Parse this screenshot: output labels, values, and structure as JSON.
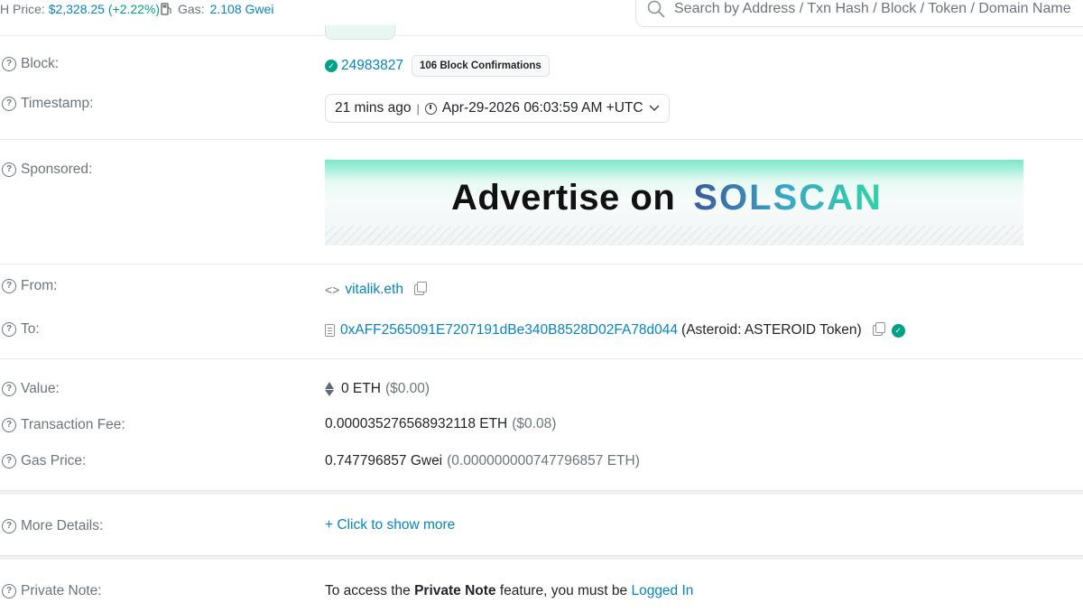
{
  "topbar": {
    "price_label": "H Price:",
    "price_value": "$2,328.25",
    "price_change": "(+2.22%)",
    "gas_label": "Gas:",
    "gas_value": "2.108 Gwei",
    "search_placeholder": "Search by Address / Txn Hash / Block / Token / Domain Name"
  },
  "rows": {
    "block": {
      "label": "Block:",
      "number": "24983827",
      "confirmations": "106 Block Confirmations"
    },
    "timestamp": {
      "label": "Timestamp:",
      "relative": "21 mins ago",
      "divider": "|",
      "absolute": "Apr-29-2026 06:03:59 AM +UTC"
    },
    "sponsored": {
      "label": "Sponsored:",
      "ad_text": "Advertise on",
      "ad_brand": "SOLSCAN"
    },
    "from": {
      "label": "From:",
      "address": "vitalik.eth"
    },
    "to": {
      "label": "To:",
      "address": "0xAFF2565091E7207191dBe340B8528D02FA78d044",
      "name": "(Asteroid: ASTEROID Token)"
    },
    "value": {
      "label": "Value:",
      "amount": "0 ETH",
      "usd": "($0.00)"
    },
    "fee": {
      "label": "Transaction Fee:",
      "amount": "0.000035276568932118 ETH",
      "usd": "($0.08)"
    },
    "gas_price": {
      "label": "Gas Price:",
      "amount": "0.747796857 Gwei",
      "eth": "(0.000000000747796857 ETH)"
    },
    "more": {
      "label": "More Details:",
      "link": "+ Click to show more"
    },
    "note": {
      "label": "Private Note:",
      "text_before": "To access the ",
      "text_bold": "Private Note",
      "text_after": " feature, you must be ",
      "link": "Logged In"
    }
  },
  "colors": {
    "link": "#0784c3",
    "success": "#00a186",
    "muted": "#6c757d"
  },
  "icons": [
    "help-icon",
    "check-circle-icon",
    "clock-icon",
    "chevron-down-icon",
    "copy-icon",
    "contract-document-icon",
    "eth-diamond-icon",
    "ens-icon",
    "search-icon",
    "gas-pump-icon"
  ]
}
